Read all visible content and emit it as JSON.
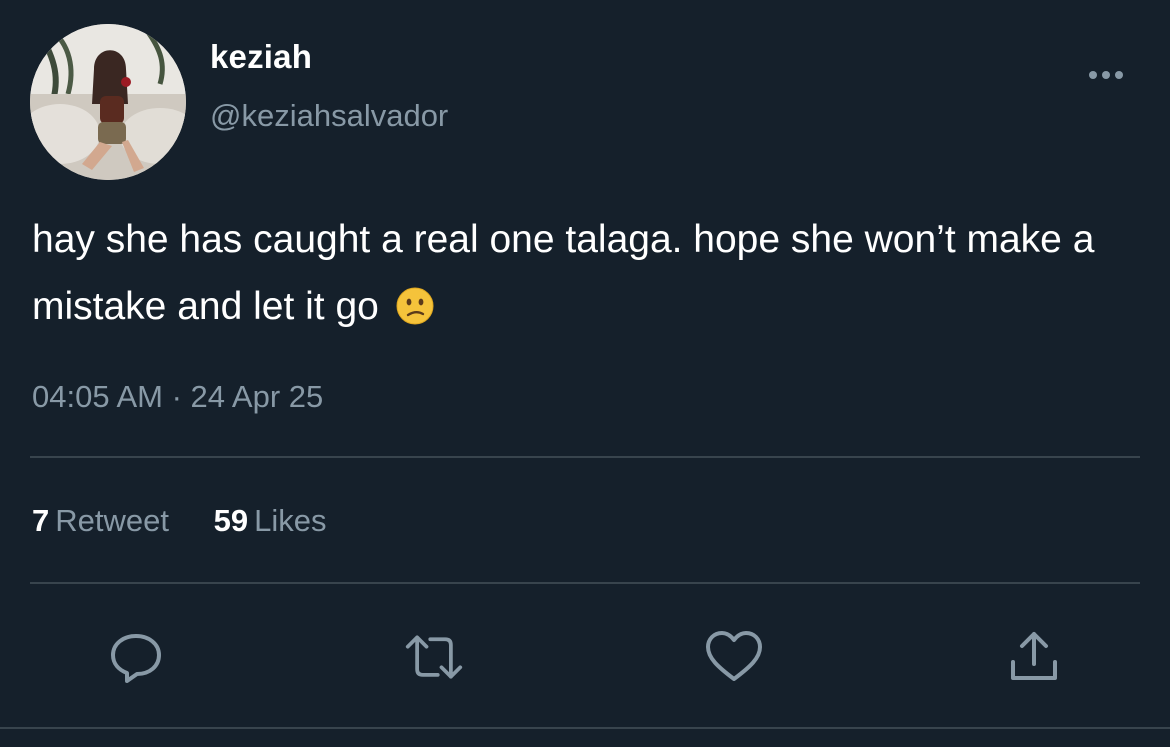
{
  "tweet": {
    "display_name": "keziah",
    "handle": "@keziahsalvador",
    "text": "hay she has caught a real one talaga. hope she won’t make a mistake and let it go",
    "emoji": "confused-face-emoji",
    "timestamp": "04:05 AM · 24 Apr 25"
  },
  "stats": {
    "retweet_count": "7",
    "retweet_label": "Retweet",
    "like_count": "59",
    "like_label": "Likes"
  },
  "icons": {
    "more": "more-options-icon",
    "reply": "reply-icon",
    "retweet": "retweet-icon",
    "like": "heart-icon",
    "share": "share-icon"
  },
  "colors": {
    "background": "#15202b",
    "secondary_text": "#8899a6",
    "divider": "#38444d",
    "icon": "#8899a6"
  }
}
